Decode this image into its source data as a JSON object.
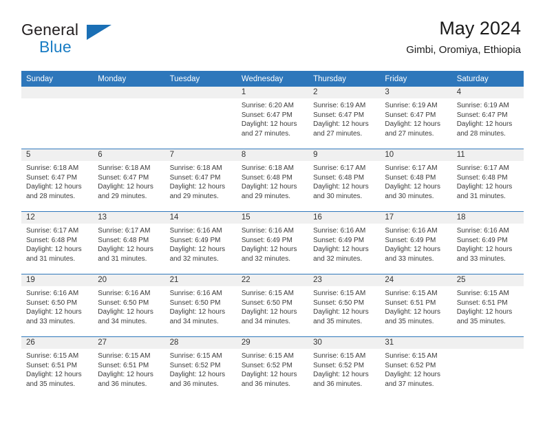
{
  "brand": {
    "name_part1": "General",
    "name_part2": "Blue",
    "triangle_icon": "triangle-logo-icon",
    "accent_blue": "#1a7dc4",
    "dark": "#231f20"
  },
  "header": {
    "title": "May 2024",
    "location": "Gimbi, Oromiya, Ethiopia"
  },
  "theme": {
    "header_blue": "#2e77bb",
    "daynum_band": "#f0f0f0",
    "text": "#3a3a3a"
  },
  "weekday_headers": [
    "Sunday",
    "Monday",
    "Tuesday",
    "Wednesday",
    "Thursday",
    "Friday",
    "Saturday"
  ],
  "weeks": [
    [
      {
        "day": "",
        "sunrise": "",
        "sunset": "",
        "daylight1": "",
        "daylight2": ""
      },
      {
        "day": "",
        "sunrise": "",
        "sunset": "",
        "daylight1": "",
        "daylight2": ""
      },
      {
        "day": "",
        "sunrise": "",
        "sunset": "",
        "daylight1": "",
        "daylight2": ""
      },
      {
        "day": "1",
        "sunrise": "Sunrise: 6:20 AM",
        "sunset": "Sunset: 6:47 PM",
        "daylight1": "Daylight: 12 hours",
        "daylight2": "and 27 minutes."
      },
      {
        "day": "2",
        "sunrise": "Sunrise: 6:19 AM",
        "sunset": "Sunset: 6:47 PM",
        "daylight1": "Daylight: 12 hours",
        "daylight2": "and 27 minutes."
      },
      {
        "day": "3",
        "sunrise": "Sunrise: 6:19 AM",
        "sunset": "Sunset: 6:47 PM",
        "daylight1": "Daylight: 12 hours",
        "daylight2": "and 27 minutes."
      },
      {
        "day": "4",
        "sunrise": "Sunrise: 6:19 AM",
        "sunset": "Sunset: 6:47 PM",
        "daylight1": "Daylight: 12 hours",
        "daylight2": "and 28 minutes."
      }
    ],
    [
      {
        "day": "5",
        "sunrise": "Sunrise: 6:18 AM",
        "sunset": "Sunset: 6:47 PM",
        "daylight1": "Daylight: 12 hours",
        "daylight2": "and 28 minutes."
      },
      {
        "day": "6",
        "sunrise": "Sunrise: 6:18 AM",
        "sunset": "Sunset: 6:47 PM",
        "daylight1": "Daylight: 12 hours",
        "daylight2": "and 29 minutes."
      },
      {
        "day": "7",
        "sunrise": "Sunrise: 6:18 AM",
        "sunset": "Sunset: 6:47 PM",
        "daylight1": "Daylight: 12 hours",
        "daylight2": "and 29 minutes."
      },
      {
        "day": "8",
        "sunrise": "Sunrise: 6:18 AM",
        "sunset": "Sunset: 6:48 PM",
        "daylight1": "Daylight: 12 hours",
        "daylight2": "and 29 minutes."
      },
      {
        "day": "9",
        "sunrise": "Sunrise: 6:17 AM",
        "sunset": "Sunset: 6:48 PM",
        "daylight1": "Daylight: 12 hours",
        "daylight2": "and 30 minutes."
      },
      {
        "day": "10",
        "sunrise": "Sunrise: 6:17 AM",
        "sunset": "Sunset: 6:48 PM",
        "daylight1": "Daylight: 12 hours",
        "daylight2": "and 30 minutes."
      },
      {
        "day": "11",
        "sunrise": "Sunrise: 6:17 AM",
        "sunset": "Sunset: 6:48 PM",
        "daylight1": "Daylight: 12 hours",
        "daylight2": "and 31 minutes."
      }
    ],
    [
      {
        "day": "12",
        "sunrise": "Sunrise: 6:17 AM",
        "sunset": "Sunset: 6:48 PM",
        "daylight1": "Daylight: 12 hours",
        "daylight2": "and 31 minutes."
      },
      {
        "day": "13",
        "sunrise": "Sunrise: 6:17 AM",
        "sunset": "Sunset: 6:48 PM",
        "daylight1": "Daylight: 12 hours",
        "daylight2": "and 31 minutes."
      },
      {
        "day": "14",
        "sunrise": "Sunrise: 6:16 AM",
        "sunset": "Sunset: 6:49 PM",
        "daylight1": "Daylight: 12 hours",
        "daylight2": "and 32 minutes."
      },
      {
        "day": "15",
        "sunrise": "Sunrise: 6:16 AM",
        "sunset": "Sunset: 6:49 PM",
        "daylight1": "Daylight: 12 hours",
        "daylight2": "and 32 minutes."
      },
      {
        "day": "16",
        "sunrise": "Sunrise: 6:16 AM",
        "sunset": "Sunset: 6:49 PM",
        "daylight1": "Daylight: 12 hours",
        "daylight2": "and 32 minutes."
      },
      {
        "day": "17",
        "sunrise": "Sunrise: 6:16 AM",
        "sunset": "Sunset: 6:49 PM",
        "daylight1": "Daylight: 12 hours",
        "daylight2": "and 33 minutes."
      },
      {
        "day": "18",
        "sunrise": "Sunrise: 6:16 AM",
        "sunset": "Sunset: 6:49 PM",
        "daylight1": "Daylight: 12 hours",
        "daylight2": "and 33 minutes."
      }
    ],
    [
      {
        "day": "19",
        "sunrise": "Sunrise: 6:16 AM",
        "sunset": "Sunset: 6:50 PM",
        "daylight1": "Daylight: 12 hours",
        "daylight2": "and 33 minutes."
      },
      {
        "day": "20",
        "sunrise": "Sunrise: 6:16 AM",
        "sunset": "Sunset: 6:50 PM",
        "daylight1": "Daylight: 12 hours",
        "daylight2": "and 34 minutes."
      },
      {
        "day": "21",
        "sunrise": "Sunrise: 6:16 AM",
        "sunset": "Sunset: 6:50 PM",
        "daylight1": "Daylight: 12 hours",
        "daylight2": "and 34 minutes."
      },
      {
        "day": "22",
        "sunrise": "Sunrise: 6:15 AM",
        "sunset": "Sunset: 6:50 PM",
        "daylight1": "Daylight: 12 hours",
        "daylight2": "and 34 minutes."
      },
      {
        "day": "23",
        "sunrise": "Sunrise: 6:15 AM",
        "sunset": "Sunset: 6:50 PM",
        "daylight1": "Daylight: 12 hours",
        "daylight2": "and 35 minutes."
      },
      {
        "day": "24",
        "sunrise": "Sunrise: 6:15 AM",
        "sunset": "Sunset: 6:51 PM",
        "daylight1": "Daylight: 12 hours",
        "daylight2": "and 35 minutes."
      },
      {
        "day": "25",
        "sunrise": "Sunrise: 6:15 AM",
        "sunset": "Sunset: 6:51 PM",
        "daylight1": "Daylight: 12 hours",
        "daylight2": "and 35 minutes."
      }
    ],
    [
      {
        "day": "26",
        "sunrise": "Sunrise: 6:15 AM",
        "sunset": "Sunset: 6:51 PM",
        "daylight1": "Daylight: 12 hours",
        "daylight2": "and 35 minutes."
      },
      {
        "day": "27",
        "sunrise": "Sunrise: 6:15 AM",
        "sunset": "Sunset: 6:51 PM",
        "daylight1": "Daylight: 12 hours",
        "daylight2": "and 36 minutes."
      },
      {
        "day": "28",
        "sunrise": "Sunrise: 6:15 AM",
        "sunset": "Sunset: 6:52 PM",
        "daylight1": "Daylight: 12 hours",
        "daylight2": "and 36 minutes."
      },
      {
        "day": "29",
        "sunrise": "Sunrise: 6:15 AM",
        "sunset": "Sunset: 6:52 PM",
        "daylight1": "Daylight: 12 hours",
        "daylight2": "and 36 minutes."
      },
      {
        "day": "30",
        "sunrise": "Sunrise: 6:15 AM",
        "sunset": "Sunset: 6:52 PM",
        "daylight1": "Daylight: 12 hours",
        "daylight2": "and 36 minutes."
      },
      {
        "day": "31",
        "sunrise": "Sunrise: 6:15 AM",
        "sunset": "Sunset: 6:52 PM",
        "daylight1": "Daylight: 12 hours",
        "daylight2": "and 37 minutes."
      },
      {
        "day": "",
        "sunrise": "",
        "sunset": "",
        "daylight1": "",
        "daylight2": ""
      }
    ]
  ]
}
